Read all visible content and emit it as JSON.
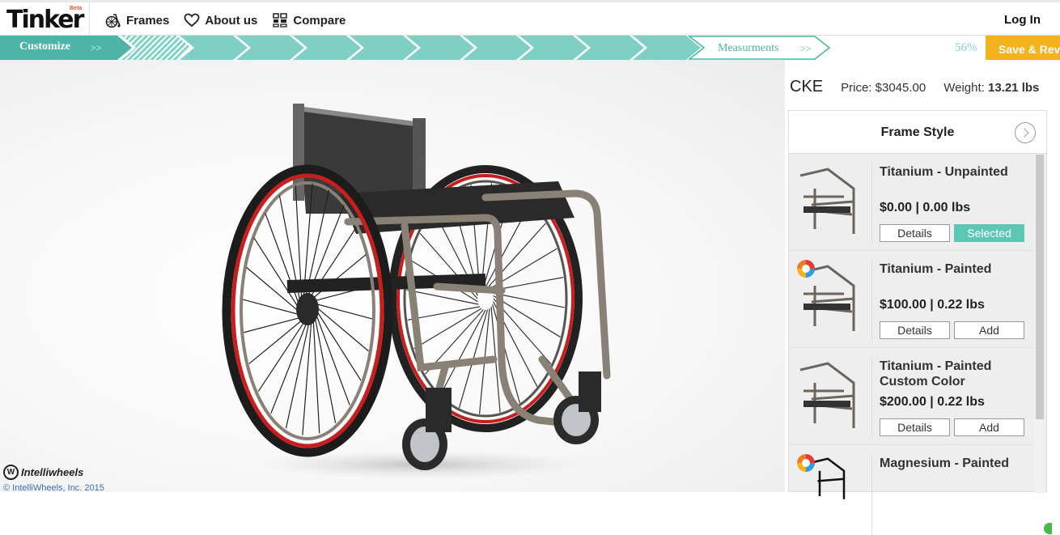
{
  "header": {
    "logo": "Tinker",
    "logo_badge": "Beta",
    "nav": [
      {
        "label": "Frames",
        "icon": "wheelchair-icon"
      },
      {
        "label": "About us",
        "icon": "heart-icon"
      },
      {
        "label": "Compare",
        "icon": "compare-grid-icon"
      }
    ],
    "login_label": "Log In"
  },
  "steps": {
    "current_label": "Customize",
    "current_arrows": ">>",
    "next_label": "Measurments",
    "next_arrows": ">>",
    "progress": "56%",
    "save_label": "Save & Review",
    "accent_color": "#5bbcb0",
    "save_color": "#f2b31c"
  },
  "viewer": {
    "brand_name": "Intelliwheels",
    "brand_mark": "W",
    "copyright": "© IntelliWheels, Inc. 2015"
  },
  "summary": {
    "model": "CKE",
    "price_label": "Price:",
    "price_value": "$3045.00",
    "weight_label": "Weight:",
    "weight_value": "13.21 lbs"
  },
  "panel": {
    "title": "Frame Style",
    "options": [
      {
        "name": "Titanium - Unpainted",
        "price": "$0.00 | 0.00 lbs",
        "details_label": "Details",
        "action_label": "Selected",
        "selected": true,
        "painted": false
      },
      {
        "name": "Titanium - Painted",
        "price": "$100.00 | 0.22 lbs",
        "details_label": "Details",
        "action_label": "Add",
        "selected": false,
        "painted": true
      },
      {
        "name": "Titanium - Painted Custom Color",
        "price": "$200.00 | 0.22 lbs",
        "details_label": "Details",
        "action_label": "Add",
        "selected": false,
        "painted": false
      },
      {
        "name": "Magnesium - Painted",
        "price": "",
        "details_label": "",
        "action_label": "",
        "selected": false,
        "painted": true
      }
    ]
  }
}
